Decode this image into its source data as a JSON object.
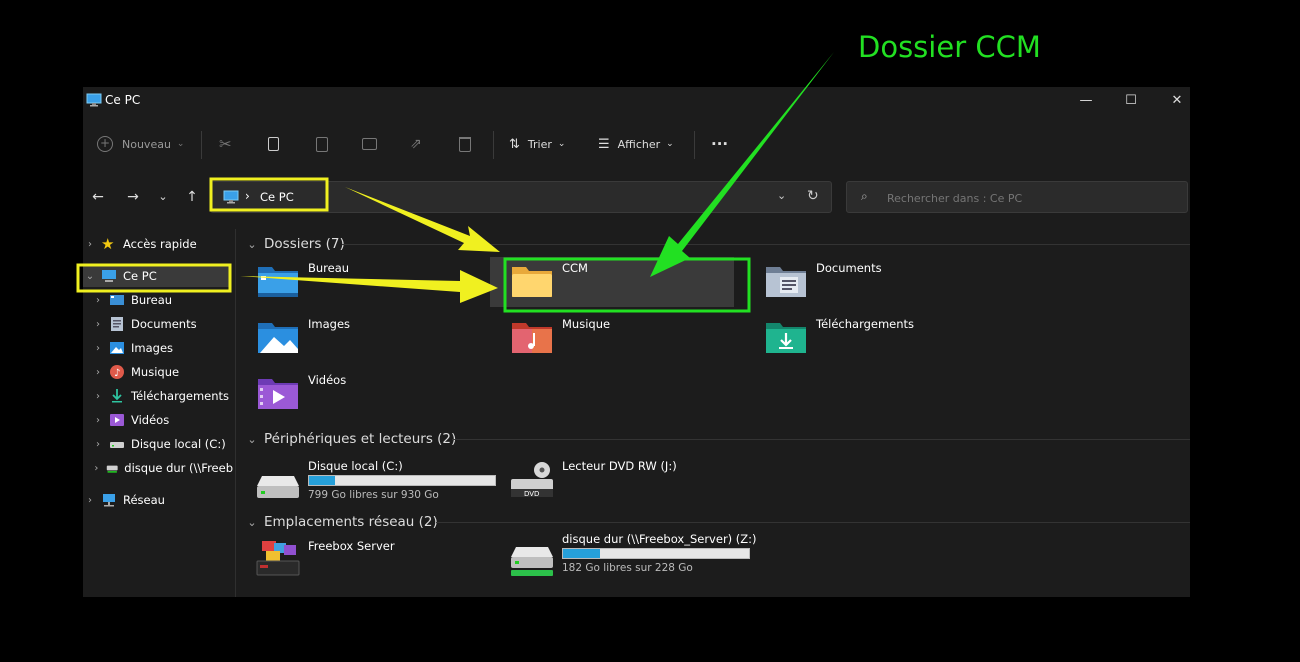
{
  "annotation": {
    "label": "Dossier CCM",
    "color": "#22e022",
    "highlight_color": "#f0f020"
  },
  "window": {
    "title": "Ce PC"
  },
  "toolbar": {
    "new_label": "Nouveau",
    "sort_label": "Trier",
    "view_label": "Afficher",
    "more_label": "···"
  },
  "address": {
    "path": "Ce PC",
    "separator": "›"
  },
  "search": {
    "placeholder": "Rechercher dans : Ce PC"
  },
  "sidebar": {
    "items": [
      {
        "label": "Accès rapide"
      },
      {
        "label": "Ce PC"
      },
      {
        "label": "Bureau"
      },
      {
        "label": "Documents"
      },
      {
        "label": "Images"
      },
      {
        "label": "Musique"
      },
      {
        "label": "Téléchargements"
      },
      {
        "label": "Vidéos"
      },
      {
        "label": "Disque local (C:)"
      },
      {
        "label": "disque dur (\\\\Freeb"
      },
      {
        "label": "Réseau"
      }
    ]
  },
  "folders": {
    "header": "Dossiers (7)",
    "items": [
      {
        "label": "Bureau"
      },
      {
        "label": "CCM"
      },
      {
        "label": "Documents"
      },
      {
        "label": "Images"
      },
      {
        "label": "Musique"
      },
      {
        "label": "Téléchargements"
      },
      {
        "label": "Vidéos"
      }
    ]
  },
  "devices": {
    "header": "Périphériques et lecteurs (2)",
    "items": [
      {
        "label": "Disque local (C:)",
        "sub": "799 Go libres sur 930 Go",
        "used_fraction": 0.14
      },
      {
        "label": "Lecteur DVD RW (J:)"
      }
    ]
  },
  "network": {
    "header": "Emplacements réseau (2)",
    "items": [
      {
        "label": "Freebox Server"
      },
      {
        "label": "disque dur (\\\\Freebox_Server) (Z:)",
        "sub": "182 Go libres sur 228 Go",
        "used_fraction": 0.2
      }
    ]
  }
}
